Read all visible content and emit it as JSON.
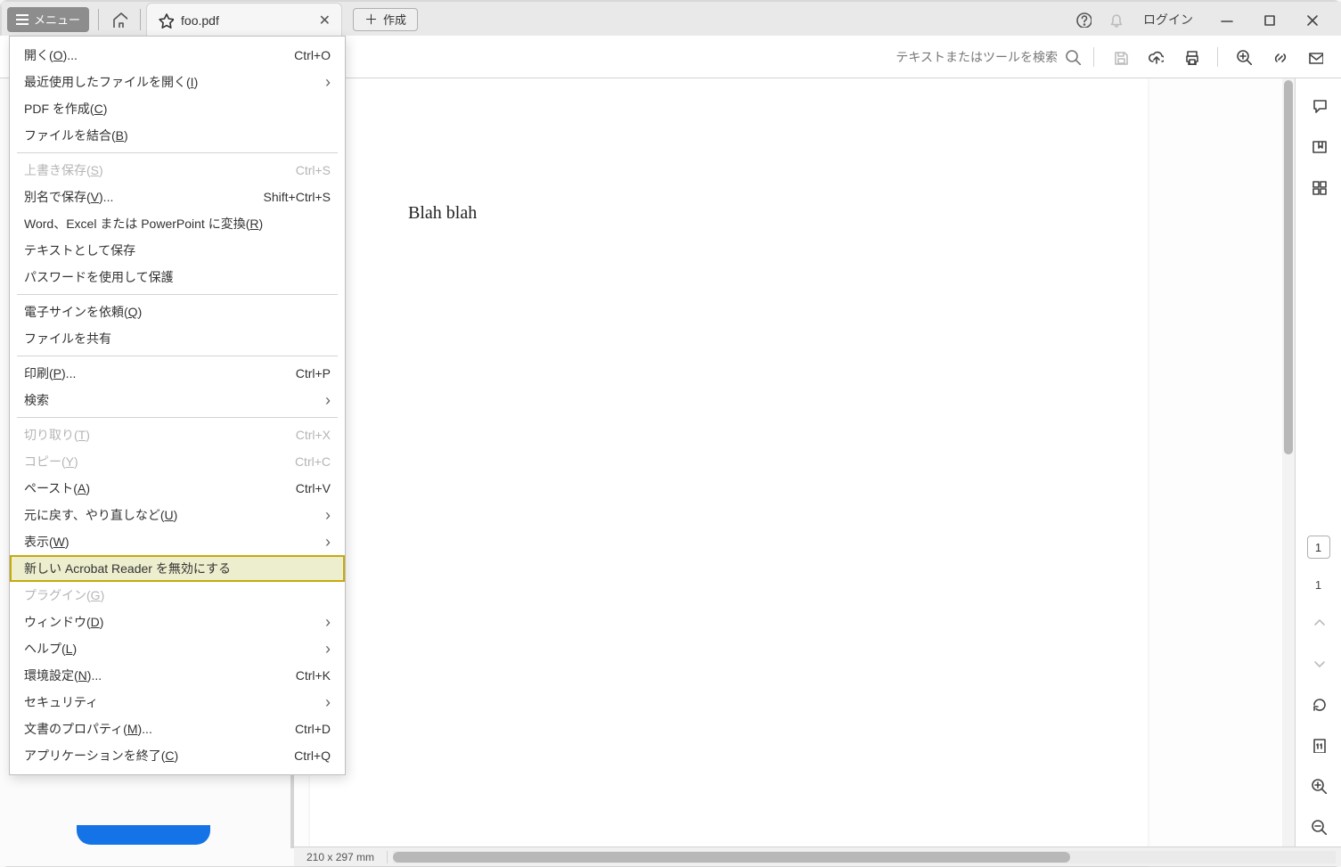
{
  "titlebar": {
    "menu_button": "メニュー",
    "tab_title": "foo.pdf",
    "create_button": "作成",
    "login": "ログイン"
  },
  "toolbar": {
    "search_placeholder": "テキストまたはツールを検索"
  },
  "document": {
    "body_text": "Blah blah"
  },
  "statusbar": {
    "page_size": "210 x 297 mm"
  },
  "right_rail": {
    "current_page": "1",
    "total_pages": "1"
  },
  "menu_items": [
    {
      "label_pre": "開く(",
      "mn": "O",
      "label_post": ")...",
      "shortcut": "Ctrl+O"
    },
    {
      "label_pre": "最近使用したファイルを開く(",
      "mn": "I",
      "label_post": ")",
      "submenu": true
    },
    {
      "label_pre": "PDF を作成(",
      "mn": "C",
      "label_post": ")"
    },
    {
      "label_pre": "ファイルを結合(",
      "mn": "B",
      "label_post": ")"
    },
    {
      "sep": true
    },
    {
      "label_pre": "上書き保存(",
      "mn": "S",
      "label_post": ")",
      "shortcut": "Ctrl+S",
      "disabled": true
    },
    {
      "label_pre": "別名で保存(",
      "mn": "V",
      "label_post": ")...",
      "shortcut": "Shift+Ctrl+S"
    },
    {
      "label_pre": "Word、Excel または PowerPoint に変換(",
      "mn": "R",
      "label_post": ")"
    },
    {
      "label_pre": "テキストとして保存",
      "mn": "",
      "label_post": ""
    },
    {
      "label_pre": "パスワードを使用して保護",
      "mn": "",
      "label_post": ""
    },
    {
      "sep": true
    },
    {
      "label_pre": "電子サインを依頼(",
      "mn": "Q",
      "label_post": ")"
    },
    {
      "label_pre": "ファイルを共有",
      "mn": "",
      "label_post": ""
    },
    {
      "sep": true
    },
    {
      "label_pre": "印刷(",
      "mn": "P",
      "label_post": ")...",
      "shortcut": "Ctrl+P"
    },
    {
      "label_pre": "検索",
      "mn": "",
      "label_post": "",
      "submenu": true
    },
    {
      "sep": true
    },
    {
      "label_pre": "切り取り(",
      "mn": "T",
      "label_post": ")",
      "shortcut": "Ctrl+X",
      "disabled": true
    },
    {
      "label_pre": "コピー(",
      "mn": "Y",
      "label_post": ")",
      "shortcut": "Ctrl+C",
      "disabled": true
    },
    {
      "label_pre": "ペースト(",
      "mn": "A",
      "label_post": ")",
      "shortcut": "Ctrl+V"
    },
    {
      "label_pre": "元に戻す、やり直しなど(",
      "mn": "U",
      "label_post": ")",
      "submenu": true
    },
    {
      "label_pre": "表示(",
      "mn": "W",
      "label_post": ")",
      "submenu": true
    },
    {
      "label_pre": "新しい Acrobat Reader を無効にする",
      "mn": "",
      "label_post": "",
      "highlight": true
    },
    {
      "label_pre": "プラグイン(",
      "mn": "G",
      "label_post": ")",
      "disabled": true
    },
    {
      "label_pre": "ウィンドウ(",
      "mn": "D",
      "label_post": ")",
      "submenu": true
    },
    {
      "label_pre": "ヘルプ(",
      "mn": "L",
      "label_post": ")",
      "submenu": true
    },
    {
      "label_pre": "環境設定(",
      "mn": "N",
      "label_post": ")...",
      "shortcut": "Ctrl+K"
    },
    {
      "label_pre": "セキュリティ",
      "mn": "",
      "label_post": "",
      "submenu": true
    },
    {
      "label_pre": "文書のプロパティ(",
      "mn": "M",
      "label_post": ")...",
      "shortcut": "Ctrl+D"
    },
    {
      "label_pre": "アプリケーションを終了(",
      "mn": "C",
      "label_post": ")",
      "shortcut": "Ctrl+Q"
    }
  ]
}
